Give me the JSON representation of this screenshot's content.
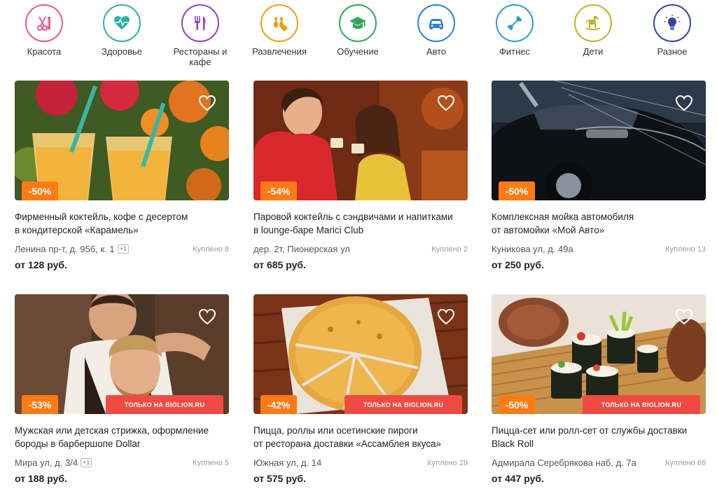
{
  "categories": [
    {
      "label": "Красота",
      "icon": "scissors-comb-icon",
      "color": "#e8578f"
    },
    {
      "label": "Здоровье",
      "icon": "heart-pulse-icon",
      "color": "#26b3a4"
    },
    {
      "label": "Рестораны и кафе",
      "icon": "fork-knife-icon",
      "color": "#8e44c4"
    },
    {
      "label": "Развлечения",
      "icon": "bowling-icon",
      "color": "#f39c12"
    },
    {
      "label": "Обучение",
      "icon": "graduation-cap-icon",
      "color": "#2eaa55"
    },
    {
      "label": "Авто",
      "icon": "car-icon",
      "color": "#2a7ed6"
    },
    {
      "label": "Фитнес",
      "icon": "dumbbell-icon",
      "color": "#2a9fd6"
    },
    {
      "label": "Дети",
      "icon": "rocking-horse-icon",
      "color": "#b9b623"
    },
    {
      "label": "Разное",
      "icon": "lightbulb-icon",
      "color": "#3a3fa8"
    }
  ],
  "deals": [
    {
      "discount": "-50%",
      "only_label": "",
      "title_line1": "Фирменный коктейль, кофе с десертом",
      "title_line2": "в кондитерской «Карамель»",
      "address": "Ленина пр-т, д. 95б, к. 1",
      "extra": "+1",
      "bought": "Куплено 8",
      "price": "от 128 руб.",
      "image": "cocktails-photo"
    },
    {
      "discount": "-54%",
      "only_label": "",
      "title_line1": "Паровой коктейль с сэндвичами и напитками",
      "title_line2": "в lounge-баре Marici Club",
      "address": "дер. 2т, Пионерская ул",
      "extra": "",
      "bought": "Куплено 2",
      "price": "от 685 руб.",
      "image": "women-coffee-photo"
    },
    {
      "discount": "-50%",
      "only_label": "",
      "title_line1": "Комплексная мойка автомобиля",
      "title_line2": "от автомойки «Мой Авто»",
      "address": "Куникова ул, д. 49а",
      "extra": "",
      "bought": "Куплено 13",
      "price": "от 250 руб.",
      "image": "car-wash-photo"
    },
    {
      "discount": "-53%",
      "only_label": "ТОЛЬКО НА BIGLION.RU",
      "title_line1": "Мужская или детская стрижка, оформление",
      "title_line2": "бороды в барбершопе Dollar",
      "address": "Мира ул, д. 3/4",
      "extra": "+1",
      "bought": "Куплено 5",
      "price": "от 188 руб.",
      "image": "barbershop-photo"
    },
    {
      "discount": "-42%",
      "only_label": "ТОЛЬКО НА BIGLION.RU",
      "title_line1": "Пицца, роллы или осетинские пироги",
      "title_line2": "от ресторана доставки «Ассамблея вкуса»",
      "address": "Южная ул, д. 14",
      "extra": "",
      "bought": "Куплено 28",
      "price": "от 575 руб.",
      "image": "ossetian-pie-photo"
    },
    {
      "discount": "-50%",
      "only_label": "ТОЛЬКО НА BIGLION.RU",
      "title_line1": "Пицца-сет или ролл-сет от службы доставки",
      "title_line2": "Black Roll",
      "address": "Адмирала Серебрякова наб, д. 7а",
      "extra": "",
      "bought": "Куплено 66",
      "price": "от 447 руб.",
      "image": "sushi-rolls-photo"
    }
  ]
}
